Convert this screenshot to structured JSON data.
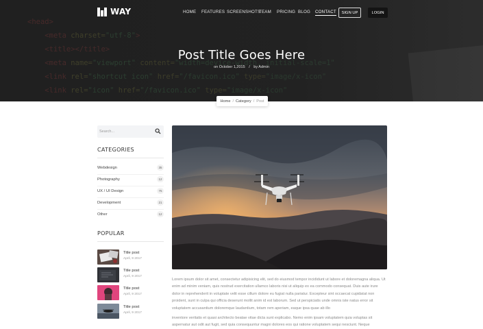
{
  "header": {
    "logo_text": "WAY",
    "nav": [
      {
        "label": "HOME",
        "active": false
      },
      {
        "label": "FEATURES",
        "active": false
      },
      {
        "label": "SCREENSHOTS",
        "active": false
      },
      {
        "label": "TEAM",
        "active": false
      },
      {
        "label": "PRICING",
        "active": false
      },
      {
        "label": "BLOG",
        "active": false
      },
      {
        "label": "CONTACT",
        "active": true
      }
    ],
    "signup_label": "SIGN UP",
    "login_label": "LOGIN"
  },
  "hero": {
    "title": "Post Title Goes Here",
    "date": "on October 1,2015",
    "separator": "/",
    "author": "by Admin"
  },
  "breadcrumb": {
    "items": [
      "Home",
      "Category",
      "Post"
    ],
    "separator": "/"
  },
  "sidebar": {
    "search_placeholder": "Search...",
    "categories_title": "CATEGORIES",
    "categories": [
      {
        "label": "Webdesign",
        "count": "35"
      },
      {
        "label": "Photography",
        "count": "12"
      },
      {
        "label": "UX / UI Design",
        "count": "75"
      },
      {
        "label": "Development",
        "count": "21"
      },
      {
        "label": "Other",
        "count": "12"
      }
    ],
    "popular_title": "POPULAR",
    "popular": [
      {
        "title": "Title post",
        "date": "April, 9 2017"
      },
      {
        "title": "Title post",
        "date": "April, 9 2017"
      },
      {
        "title": "Title post",
        "date": "April, 9 2017"
      },
      {
        "title": "Title post",
        "date": "April, 9 2017"
      }
    ]
  },
  "article": {
    "paragraphs": [
      "Lorem ipsum dolor sit amet, consectetur adipisicing elit, sed do eiusmod tempor incididunt ut labore et doloremagna aliqua. Ut enim ad minim veniam, quis nostrud exercitation ullamco laboris nisi ut aliquip ex ea commodo consequat. Duis aute irure dolor in reprehenderit in voluptate velit esse cillum dolore eu fugiat nulla pariatur. Excepteur sint occaecat cupidatat non proident, sunt in culpa qui officia deserunt mollit anim id est laborum. Sed ut perspiciatis unde omnis iste natus error sit voluptatem accusantium doloremque laudantium, totam rem aperiam, eaque ipsa quae ab illo",
      "inventore veritatis et quasi architecto beatae vitae dicta sunt explicabo. Nemo enim ipsam voluptatem quia voluptas sit aspernatur aut odit aut fugit, sed quia consequuntur magni dolores eos qui ratione voluptatem sequi nesciunt. Neque"
    ]
  },
  "colors": {
    "hero_bg": "#262626",
    "text_dark": "#333333",
    "text_muted": "#8a8a8a",
    "search_bg": "#f3f4f6",
    "login_bg": "#141414"
  },
  "icons": {
    "logo": "building-logo-icon",
    "search": "search-icon"
  }
}
